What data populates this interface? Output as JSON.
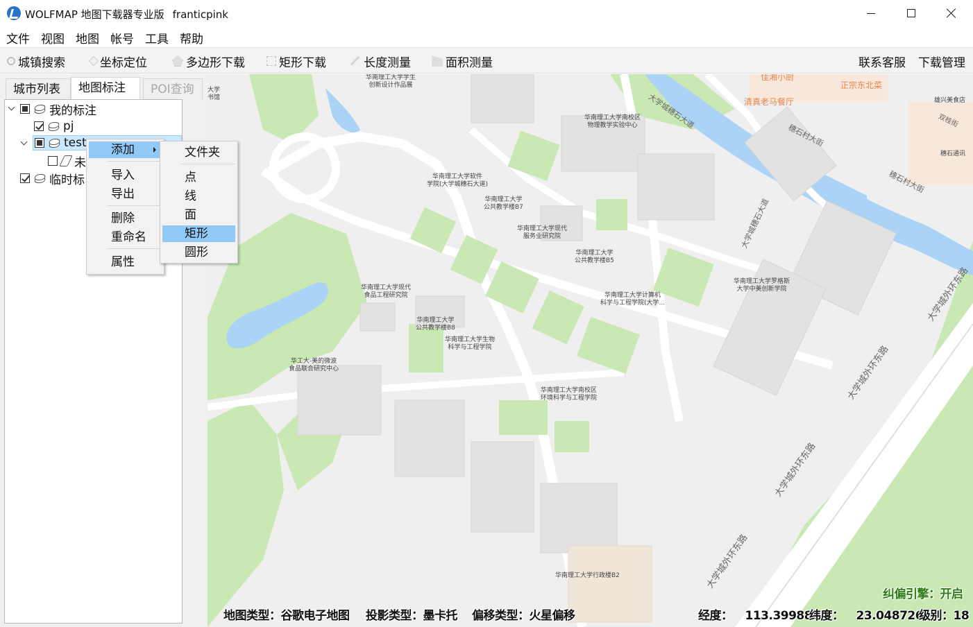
{
  "window": {
    "app_title": "WOLFMAP 地图下载器专业版",
    "username": "franticpink"
  },
  "menubar": [
    "文件",
    "视图",
    "地图",
    "帐号",
    "工具",
    "帮助"
  ],
  "toolbar": {
    "left": [
      {
        "label": "城镇搜索",
        "icon": "search-icon"
      },
      {
        "label": "坐标定位",
        "icon": "locate-icon"
      },
      {
        "label": "多边形下载",
        "icon": "polygon-icon"
      },
      {
        "label": "矩形下载",
        "icon": "rectangle-icon"
      },
      {
        "label": "长度测量",
        "icon": "ruler-icon"
      },
      {
        "label": "面积测量",
        "icon": "area-icon"
      }
    ],
    "right": [
      "联系客服",
      "下载管理"
    ]
  },
  "left_panel": {
    "tabs": [
      "城市列表",
      "地图标注",
      "POI查询"
    ],
    "tree": {
      "root": "我的标注",
      "pj": "pj",
      "test": "test",
      "child": "未",
      "temp": "临时标"
    }
  },
  "context_menu": {
    "items": [
      "添加",
      "导入",
      "导出",
      "删除",
      "重命名",
      "属性"
    ]
  },
  "submenu": {
    "items": [
      "文件夹",
      "点",
      "线",
      "面",
      "矩形",
      "圆形"
    ],
    "highlighted": "矩形"
  },
  "map": {
    "labels": [
      "华南理工大学学生\n创新设计作品展",
      "华南理工大学南校区\n物理教学实验中心",
      "华南理工大学软件\n学院(大学城穗石大道)",
      "华南理工大学\n公共教学楼B7",
      "华南理工大学现代\n服务业研究院",
      "华南理工大学\n公共教学楼B5",
      "华南理工大学现代\n食品工程研究院",
      "华南理工大学计算机\n科学与工程学院(大学...",
      "华南理工大学\n公共教学楼B8",
      "华南理工大学生物\n科学与工程学院",
      "华工大-美的微波\n食品联合研究中心",
      "华南理工大学南校区\n环境科学与工程学院",
      "华南理工大学罗格斯\n大学中美创新学院",
      "华南理工大学行政楼B2",
      "大学\n书馆"
    ],
    "roads": [
      "大学城穗石大道",
      "穗石村大街",
      "穗石村大街",
      "大学城穗石大道",
      "大学城外环东路",
      "大学城外环东路",
      "大学城外环东路",
      "大学城外环东路",
      "双桂街"
    ],
    "pois": [
      "清真老马餐厅",
      "正宗东北菜",
      "佳湘小厨"
    ],
    "small_labels": [
      "雄兴美食店",
      "穗石通讯"
    ]
  },
  "statusbar": {
    "map_type_label": "地图类型：",
    "map_type": "谷歌电子地图",
    "projection_label": "投影类型：",
    "projection": "墨卡托",
    "offset_label": "偏移类型：",
    "offset": "火星偏移",
    "lng_label": "经度：",
    "lng": "113.399885",
    "lat_label": "纬度：",
    "lat": "23.048726",
    "level_label": "级别：",
    "level": "18",
    "correction_label": "纠偏引擎：",
    "correction": "开启"
  },
  "colors": {
    "green": "#c9e8b4",
    "water": "#aad3f5",
    "building": "#e2e2e2",
    "menu_highlight": "#91c9f7",
    "selected": "#cce8ff"
  }
}
